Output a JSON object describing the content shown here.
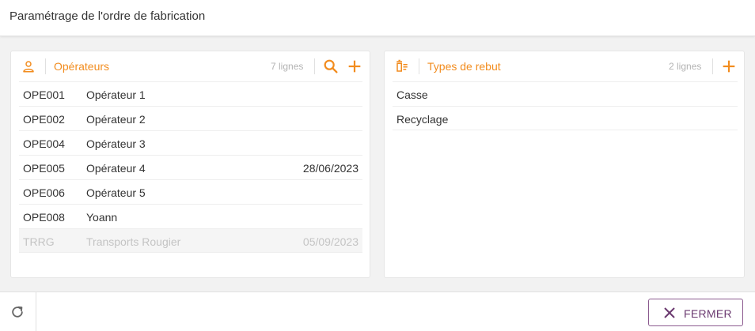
{
  "header": {
    "title": "Paramétrage de l'ordre de fabrication"
  },
  "operators": {
    "title": "Opérateurs",
    "count": "7 lignes",
    "rows": [
      {
        "code": "OPE001",
        "name": "Opérateur 1",
        "date": ""
      },
      {
        "code": "OPE002",
        "name": "Opérateur 2",
        "date": ""
      },
      {
        "code": "OPE004",
        "name": "Opérateur 3",
        "date": ""
      },
      {
        "code": "OPE005",
        "name": "Opérateur 4",
        "date": "28/06/2023"
      },
      {
        "code": "OPE006",
        "name": "Opérateur 5",
        "date": ""
      },
      {
        "code": "OPE008",
        "name": "Yoann",
        "date": ""
      },
      {
        "code": "TRRG",
        "name": "Transports Rougier",
        "date": "05/09/2023",
        "disabled": true
      }
    ]
  },
  "scrap_types": {
    "title": "Types de rebut",
    "count": "2 lignes",
    "rows": [
      {
        "label": "Casse"
      },
      {
        "label": "Recyclage"
      }
    ]
  },
  "footer": {
    "close_label": "FERMER"
  },
  "icons": {
    "operators": "person-icon",
    "scrap": "bin-list-icon",
    "search": "search-icon",
    "add": "plus-icon",
    "refresh": "refresh-icon",
    "close": "close-icon"
  },
  "colors": {
    "accent": "#f28c1e",
    "close_button": "#6b3a70",
    "muted": "#b3b3b3"
  }
}
